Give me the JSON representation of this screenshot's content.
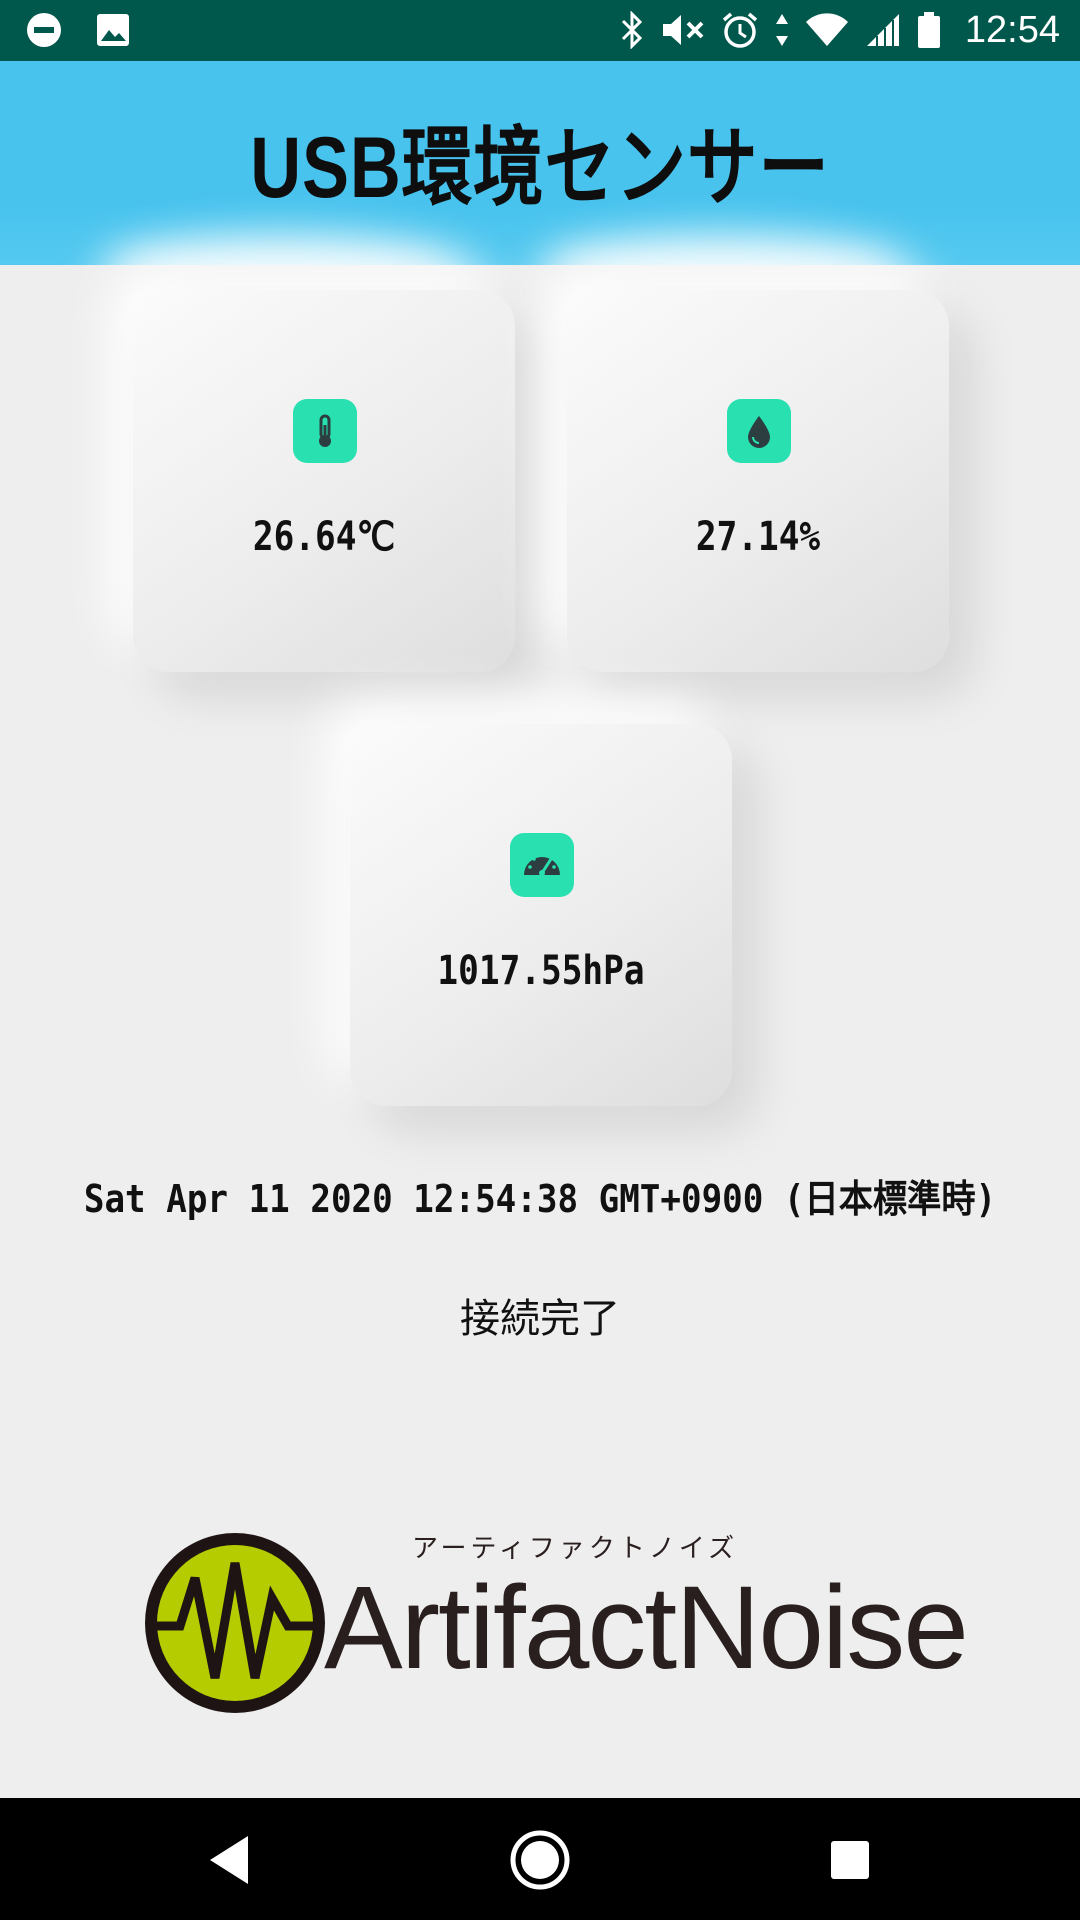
{
  "status_bar": {
    "time": "12:54",
    "left_icons": [
      "do-not-disturb-icon",
      "image-notification-icon"
    ],
    "right_icons": [
      "bluetooth-icon",
      "mute-icon",
      "alarm-icon",
      "data-arrows-icon",
      "wifi-icon",
      "signal-icon",
      "battery-icon"
    ],
    "background": "#00574b"
  },
  "header": {
    "title": "USB環境センサー",
    "background": "#47c3ee"
  },
  "cards": {
    "temperature": {
      "icon": "thermometer-icon",
      "value": "26.64℃"
    },
    "humidity": {
      "icon": "water-drop-icon",
      "value": "27.14%"
    },
    "pressure": {
      "icon": "gauge-icon",
      "value": "1017.55hPa"
    },
    "icon_color": "#29e0b0"
  },
  "datetime": "Sat Apr 11 2020 12:54:38 GMT+0900 (日本標準時)",
  "connection_status": "接続完了",
  "logo": {
    "name": "ArtifactNoise",
    "kana": "アーティファクトノイズ",
    "brand_color": "#b5cc00"
  },
  "nav_bar": {
    "buttons": [
      "back",
      "home",
      "recents"
    ]
  }
}
